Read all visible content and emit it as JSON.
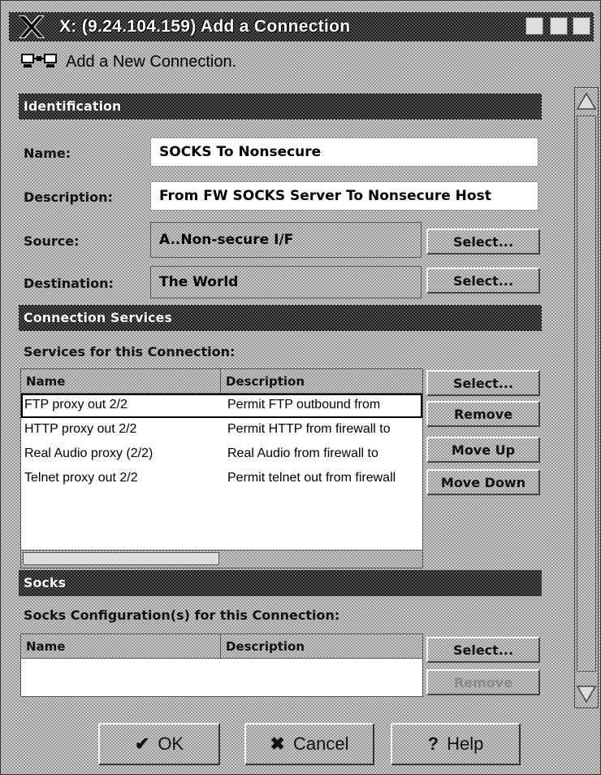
{
  "window": {
    "title": "X: (9.24.104.159) Add a Connection",
    "subtitle": "Add a New Connection."
  },
  "identification": {
    "header": "Identification",
    "name_label": "Name:",
    "name_value": "SOCKS To Nonsecure",
    "description_label": "Description:",
    "description_value": "From FW SOCKS Server To Nonsecure Host",
    "source_label": "Source:",
    "source_value": "A..Non-secure I/F",
    "destination_label": "Destination:",
    "destination_value": "The World",
    "select_label": "Select..."
  },
  "services": {
    "header": "Connection Services",
    "subheader": "Services for this Connection:",
    "columns": [
      "Name",
      "Description"
    ],
    "rows": [
      {
        "name": "FTP proxy out 2/2",
        "description": "Permit FTP outbound from"
      },
      {
        "name": "HTTP proxy out 2/2",
        "description": "Permit HTTP from firewall to"
      },
      {
        "name": "Real Audio proxy (2/2)",
        "description": "Real Audio from firewall to"
      },
      {
        "name": "Telnet proxy out 2/2",
        "description": "Permit telnet out from firewall"
      }
    ],
    "buttons": {
      "select": "Select...",
      "remove": "Remove",
      "move_up": "Move Up",
      "move_down": "Move Down"
    }
  },
  "socks": {
    "header": "Socks",
    "subheader": "Socks Configuration(s) for this Connection:",
    "columns": [
      "Name",
      "Description"
    ],
    "buttons": {
      "select": "Select...",
      "remove": "Remove"
    }
  },
  "footer": {
    "ok": "OK",
    "cancel": "Cancel",
    "help": "Help"
  }
}
